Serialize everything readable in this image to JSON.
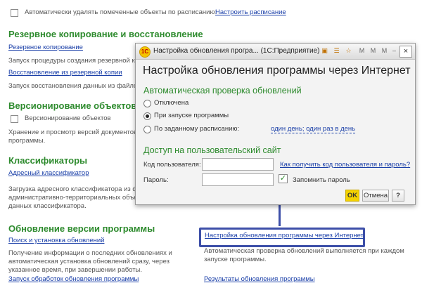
{
  "background": {
    "top_checkbox_label": "Автоматически удалять помеченные объекты по расписанию:",
    "top_link": "Настроить расписание",
    "sections": [
      {
        "title": "Резервное копирование и восстановление",
        "link1": "Резервное копирование",
        "desc1": "Запуск процедуры создания резервной коп",
        "link2": "Восстановление из резервной копии",
        "desc2": "Запуск восстановления данных из файлов р"
      },
      {
        "title": "Версионирование объектов",
        "checkbox_label": "Версионирование объектов",
        "desc1": "Хранение и просмотр версий документов и",
        "desc2": "программы."
      },
      {
        "title": "Классификаторы",
        "link1": "Адресный классификатор",
        "desc1": "Загрузка адресного классификатора из фа",
        "desc2": "административно-территориальных объект",
        "desc3": "данных классификатора."
      },
      {
        "title": "Обновление версии программы",
        "link1": "Поиск и установка обновлений",
        "desc_left": "Получение информации о последних обновлениях и автоматическая установка обновлений сразу, через указанное время, при завершении работы.",
        "link_right": "Настройка обновления программы через Интернет",
        "desc_right": "Автоматическая проверка обновлений выполняется при каждом запуске программы.",
        "bottom_left": "Запуск обработок обновления программы",
        "bottom_right": "Результаты обновления программы"
      }
    ]
  },
  "dialog": {
    "window_title": "Настройка обновления програ... (1С:Предприятие)",
    "title": "Настройка обновления программы через Интернет",
    "auto_check": {
      "heading": "Автоматическая проверка обновлений",
      "options": [
        "Отключена",
        "При запуске программы",
        "По заданному расписанию:"
      ],
      "selected": 1,
      "schedule_link": "один день; один раз в день"
    },
    "access": {
      "heading": "Доступ на пользовательский сайт",
      "user_label": "Код пользователя:",
      "user_value": "",
      "password_label": "Пароль:",
      "password_value": "",
      "help_link": "Как получить код пользователя и пароль?",
      "remember_label": "Запомнить пароль",
      "remember_checked": true
    },
    "buttons": {
      "ok": "OK",
      "cancel": "Отмена",
      "help": "?"
    },
    "title_icons": [
      "save-icon",
      "list-icon",
      "bookmark-icon",
      "memory-icon",
      "memory-plus-icon",
      "memory-minus-icon",
      "minimize-icon",
      "maximize-icon"
    ]
  },
  "colors": {
    "section_title": "#2e8b2e",
    "link": "#1a3fa8",
    "highlight_frame": "#3d4fa8",
    "ok_button": "#f3d200"
  }
}
